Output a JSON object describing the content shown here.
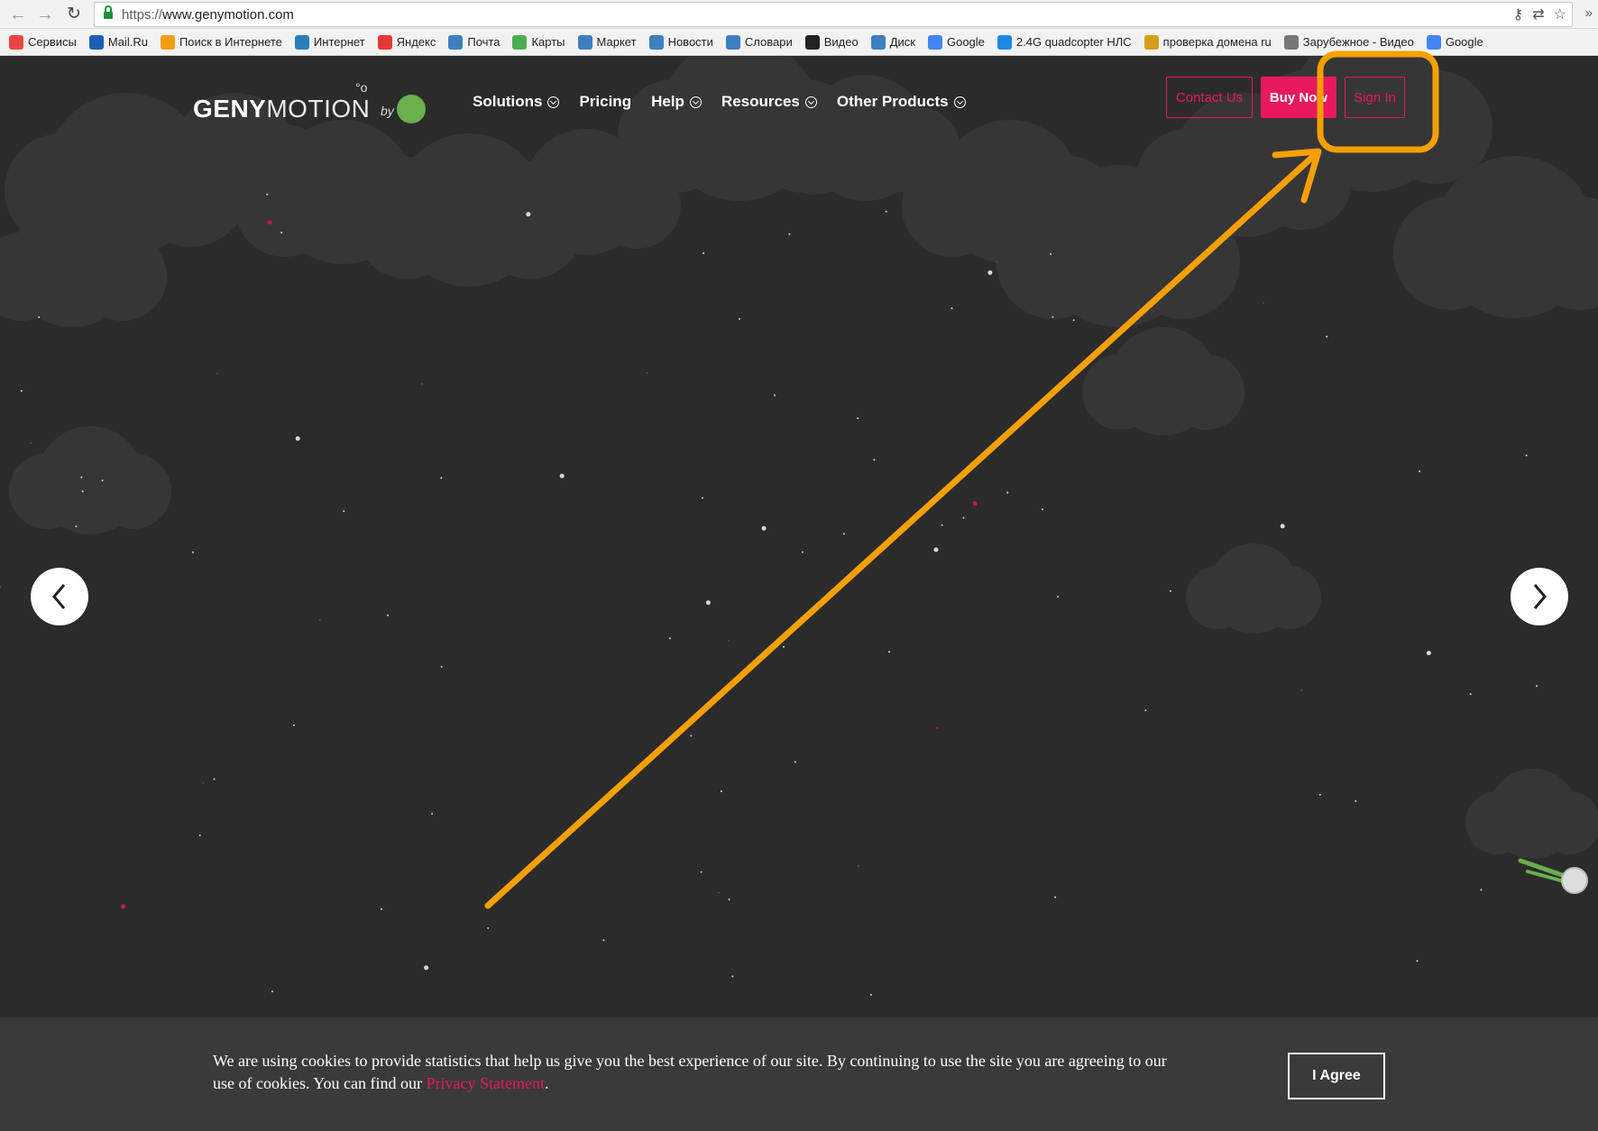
{
  "browser": {
    "url_scheme": "https://",
    "url_host": "www.genymotion.com",
    "bookmarks": [
      {
        "label": "Сервисы",
        "color": "#e44"
      },
      {
        "label": "Mail.Ru",
        "color": "#1a5fb4"
      },
      {
        "label": "Поиск в Интернете",
        "color": "#f39c12"
      },
      {
        "label": "Интернет",
        "color": "#2980b9"
      },
      {
        "label": "Яндекс",
        "color": "#e53935"
      },
      {
        "label": "Почта",
        "color": "#3f7fbf"
      },
      {
        "label": "Карты",
        "color": "#4caf50"
      },
      {
        "label": "Маркет",
        "color": "#3f7fbf"
      },
      {
        "label": "Новости",
        "color": "#3f7fbf"
      },
      {
        "label": "Словари",
        "color": "#3f7fbf"
      },
      {
        "label": "Видео",
        "color": "#222"
      },
      {
        "label": "Диск",
        "color": "#3f7fbf"
      },
      {
        "label": "Google",
        "color": "#4285f4"
      },
      {
        "label": "2.4G quadcopter НЛС",
        "color": "#1e88e5"
      },
      {
        "label": "проверка домена ru",
        "color": "#d4a017"
      },
      {
        "label": "Зарубежное - Видео",
        "color": "#777"
      },
      {
        "label": "Google",
        "color": "#4285f4"
      }
    ],
    "more": "»"
  },
  "site": {
    "logo_bold": "GENY",
    "logo_light": "MOTION",
    "logo_by": "by",
    "nav": [
      {
        "label": "Solutions",
        "dropdown": true
      },
      {
        "label": "Pricing",
        "dropdown": false
      },
      {
        "label": "Help",
        "dropdown": true
      },
      {
        "label": "Resources",
        "dropdown": true
      },
      {
        "label": "Other Products",
        "dropdown": true
      }
    ],
    "contact_label": "Contact Us",
    "buy_label": "Buy Now",
    "signin_label": "Sign In",
    "accent": "#e8195c"
  },
  "cookie": {
    "text": "We are using cookies to provide statistics that help us give you the best experience of our site. By continuing to use the site you are agreeing to our use of cookies. You can find our ",
    "link": "Privacy Statement",
    "end": ".",
    "agree_label": "I Agree"
  },
  "annotation": {
    "color": "#f5a000",
    "highlight_target": "Sign In"
  }
}
